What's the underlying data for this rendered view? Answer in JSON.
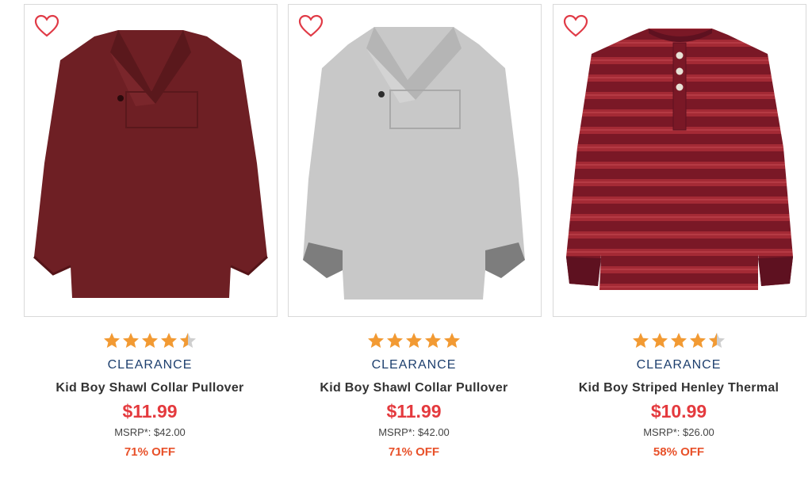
{
  "colors": {
    "heart": "#e03a46",
    "star_filled": "#f29a33",
    "star_empty": "#cfcfcf",
    "price": "#e43a3e",
    "discount": "#e8512a",
    "badge": "#1d3f6e"
  },
  "products": [
    {
      "badge": "CLEARANCE",
      "name": "Kid Boy Shawl Collar Pullover",
      "price": "$11.99",
      "msrp": "MSRP*: $42.00",
      "discount": "71% OFF",
      "rating": 4.5,
      "image": "burgundy-shawl-pullover",
      "garment_color": "#6e1f24"
    },
    {
      "badge": "CLEARANCE",
      "name": "Kid Boy Shawl Collar Pullover",
      "price": "$11.99",
      "msrp": "MSRP*: $42.00",
      "discount": "71% OFF",
      "rating": 5,
      "image": "gray-shawl-pullover",
      "garment_color": "#c8c8c8"
    },
    {
      "badge": "CLEARANCE",
      "name": "Kid Boy Striped Henley Thermal",
      "price": "$10.99",
      "msrp": "MSRP*: $26.00",
      "discount": "58% OFF",
      "rating": 4.5,
      "image": "red-striped-henley",
      "garment_color": "#8a1f2b"
    }
  ]
}
